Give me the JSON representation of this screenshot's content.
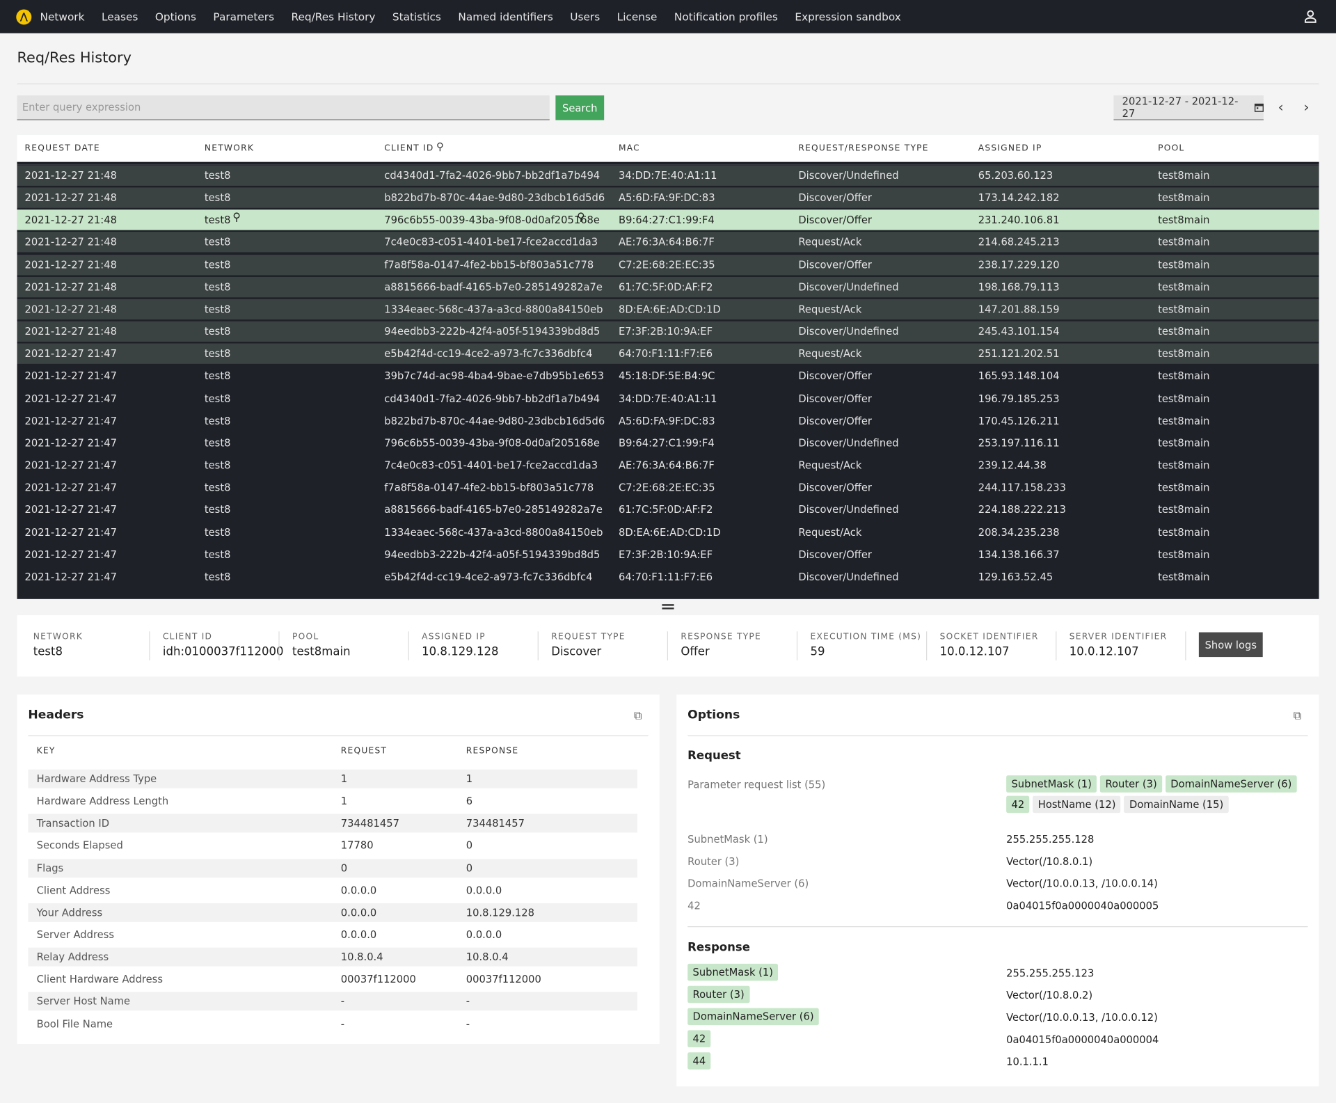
{
  "nav": {
    "items": [
      "Network",
      "Leases",
      "Options",
      "Parameters",
      "Req/Res History",
      "Statistics",
      "Named identifiers",
      "Users",
      "License",
      "Notification profiles",
      "Expression sandbox"
    ],
    "logo_icon": "logo-icon",
    "user_icon": "user-icon"
  },
  "page": {
    "title": "Req/Res History"
  },
  "search": {
    "placeholder": "Enter query expression",
    "value": "",
    "button": "Search",
    "date_range": "2021-12-27 - 2021-12-27"
  },
  "table": {
    "columns": [
      "REQUEST DATE",
      "NETWORK",
      "CLIENT ID",
      "MAC",
      "REQUEST/RESPONSE TYPE",
      "ASSIGNED IP",
      "POOL"
    ],
    "selected_index": 2,
    "rows": [
      [
        "2021-12-27  21:48",
        "test8",
        "cd4340d1-7fa2-4026-9bb7-bb2df1a7b494",
        "34:DD:7E:40:A1:11",
        "Discover/Undefined",
        "65.203.60.123",
        "test8main"
      ],
      [
        "2021-12-27  21:48",
        "test8",
        "b822bd7b-870c-44ae-9d80-23dbcb16d5d6",
        "A5:6D:FA:9F:DC:83",
        "Discover/Offer",
        "173.14.242.182",
        "test8main"
      ],
      [
        "2021-12-27  21:48",
        "test8",
        "796c6b55-0039-43ba-9f08-0d0af205168e",
        "B9:64:27:C1:99:F4",
        "Discover/Offer",
        "231.240.106.81",
        "test8main"
      ],
      [
        "2021-12-27  21:48",
        "test8",
        "7c4e0c83-c051-4401-be17-fce2accd1da3",
        "AE:76:3A:64:B6:7F",
        "Request/Ack",
        "214.68.245.213",
        "test8main"
      ],
      [
        "2021-12-27  21:48",
        "test8",
        "f7a8f58a-0147-4fe2-bb15-bf803a51c778",
        "C7:2E:68:2E:EC:35",
        "Discover/Offer",
        "238.17.229.120",
        "test8main"
      ],
      [
        "2021-12-27  21:48",
        "test8",
        "a8815666-badf-4165-b7e0-285149282a7e",
        "61:7C:5F:0D:AF:F2",
        "Discover/Undefined",
        "198.168.79.113",
        "test8main"
      ],
      [
        "2021-12-27  21:48",
        "test8",
        "1334eaec-568c-437a-a3cd-8800a84150eb",
        "8D:EA:6E:AD:CD:1D",
        "Request/Ack",
        "147.201.88.159",
        "test8main"
      ],
      [
        "2021-12-27  21:48",
        "test8",
        "94eedbb3-222b-42f4-a05f-5194339bd8d5",
        "E7:3F:2B:10:9A:EF",
        "Discover/Undefined",
        "245.43.101.154",
        "test8main"
      ],
      [
        "2021-12-27  21:47",
        "test8",
        "e5b42f4d-cc19-4ce2-a973-fc7c336dbfc4",
        "64:70:F1:11:F7:E6",
        "Request/Ack",
        "251.121.202.51",
        "test8main"
      ],
      [
        "2021-12-27  21:47",
        "test8",
        "39b7c74d-ac98-4ba4-9bae-e7db95b1e653",
        "45:18:DF:5E:B4:9C",
        "Discover/Offer",
        "165.93.148.104",
        "test8main"
      ],
      [
        "2021-12-27  21:47",
        "test8",
        "cd4340d1-7fa2-4026-9bb7-bb2df1a7b494",
        "34:DD:7E:40:A1:11",
        "Discover/Offer",
        "196.79.185.253",
        "test8main"
      ],
      [
        "2021-12-27  21:47",
        "test8",
        "b822bd7b-870c-44ae-9d80-23dbcb16d5d6",
        "A5:6D:FA:9F:DC:83",
        "Discover/Offer",
        "170.45.126.211",
        "test8main"
      ],
      [
        "2021-12-27  21:47",
        "test8",
        "796c6b55-0039-43ba-9f08-0d0af205168e",
        "B9:64:27:C1:99:F4",
        "Discover/Undefined",
        "253.197.116.11",
        "test8main"
      ],
      [
        "2021-12-27  21:47",
        "test8",
        "7c4e0c83-c051-4401-be17-fce2accd1da3",
        "AE:76:3A:64:B6:7F",
        "Request/Ack",
        "239.12.44.38",
        "test8main"
      ],
      [
        "2021-12-27  21:47",
        "test8",
        "f7a8f58a-0147-4fe2-bb15-bf803a51c778",
        "C7:2E:68:2E:EC:35",
        "Discover/Offer",
        "244.117.158.233",
        "test8main"
      ],
      [
        "2021-12-27  21:47",
        "test8",
        "a8815666-badf-4165-b7e0-285149282a7e",
        "61:7C:5F:0D:AF:F2",
        "Discover/Undefined",
        "224.188.222.213",
        "test8main"
      ],
      [
        "2021-12-27  21:47",
        "test8",
        "1334eaec-568c-437a-a3cd-8800a84150eb",
        "8D:EA:6E:AD:CD:1D",
        "Request/Ack",
        "208.34.235.238",
        "test8main"
      ],
      [
        "2021-12-27  21:47",
        "test8",
        "94eedbb3-222b-42f4-a05f-5194339bd8d5",
        "E7:3F:2B:10:9A:EF",
        "Discover/Offer",
        "134.138.166.37",
        "test8main"
      ],
      [
        "2021-12-27  21:47",
        "test8",
        "e5b42f4d-cc19-4ce2-a973-fc7c336dbfc4",
        "64:70:F1:11:F7:E6",
        "Discover/Undefined",
        "129.163.52.45",
        "test8main"
      ]
    ]
  },
  "details": {
    "fields": [
      {
        "label": "NETWORK",
        "value": "test8"
      },
      {
        "label": "CLIENT ID",
        "value": "idh:0100037f112000"
      },
      {
        "label": "POOL",
        "value": "test8main"
      },
      {
        "label": "ASSIGNED IP",
        "value": "10.8.129.128"
      },
      {
        "label": "REQUEST TYPE",
        "value": "Discover"
      },
      {
        "label": "RESPONSE TYPE",
        "value": "Offer"
      },
      {
        "label": "EXECUTION TIME (MS)",
        "value": "59"
      },
      {
        "label": "SOCKET IDENTIFIER",
        "value": "10.0.12.107"
      },
      {
        "label": "SERVER IDENTIFIER",
        "value": "10.0.12.107"
      }
    ],
    "show_logs": "Show logs"
  },
  "headers": {
    "title": "Headers",
    "columns": [
      "KEY",
      "REQUEST",
      "RESPONSE"
    ],
    "rows": [
      [
        "Hardware Address Type",
        "1",
        "1"
      ],
      [
        "Hardware Address Length",
        "1",
        "6"
      ],
      [
        "Transaction ID",
        "734481457",
        "734481457"
      ],
      [
        "Seconds Elapsed",
        "17780",
        "0"
      ],
      [
        "Flags",
        "0",
        "0"
      ],
      [
        "Client Address",
        "0.0.0.0",
        "0.0.0.0"
      ],
      [
        "Your Address",
        "0.0.0.0",
        "10.8.129.128"
      ],
      [
        "Server Address",
        "0.0.0.0",
        "0.0.0.0"
      ],
      [
        "Relay Address",
        "10.8.0.4",
        "10.8.0.4"
      ],
      [
        "Client Hardware Address",
        "00037f112000",
        "00037f112000"
      ],
      [
        "Server Host Name",
        "-",
        "-"
      ],
      [
        "Bool File Name",
        "-",
        "-"
      ]
    ]
  },
  "options": {
    "title": "Options",
    "request": {
      "title": "Request",
      "param_list_label": "Parameter request list (55)",
      "param_chips": [
        {
          "label": "SubnetMask (1)",
          "matched": true
        },
        {
          "label": "Router (3)",
          "matched": true
        },
        {
          "label": "DomainNameServer (6)",
          "matched": true
        },
        {
          "label": "42",
          "matched": true
        },
        {
          "label": "HostName (12)",
          "matched": false
        },
        {
          "label": "DomainName (15)",
          "matched": false
        }
      ],
      "rows": [
        [
          "SubnetMask (1)",
          "255.255.255.128"
        ],
        [
          "Router (3)",
          "Vector(/10.8.0.1)"
        ],
        [
          "DomainNameServer (6)",
          "Vector(/10.0.0.13, /10.0.0.14)"
        ],
        [
          "42",
          "0a04015f0a0000040a000005"
        ]
      ]
    },
    "response": {
      "title": "Response",
      "rows": [
        [
          "SubnetMask (1)",
          "255.255.255.123"
        ],
        [
          "Router (3)",
          "Vector(/10.8.0.2)"
        ],
        [
          "DomainNameServer (6)",
          "Vector(/10.0.0.13, /10.0.0.12)"
        ],
        [
          "42",
          "0a04015f0a0000040a000004"
        ],
        [
          "44",
          "10.1.1.1"
        ]
      ]
    }
  },
  "colors": {
    "nav_bg": "#1e2128",
    "accent": "#43a45b",
    "selected_row": "#c8e6c9",
    "chip": "#c8e6c9",
    "logo": "#f5c400"
  }
}
